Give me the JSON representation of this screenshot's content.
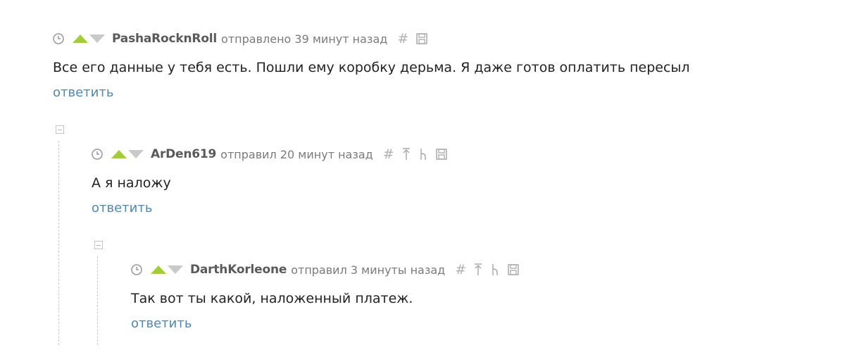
{
  "comments": [
    {
      "username": "PashaRocknRoll",
      "sent": "отправлено 39 минут назад",
      "text": "Все его данные у тебя есть. Пошли ему коробку дерьма. Я даже готов оплатить пересыл",
      "reply": "ответить",
      "tools": [
        "#"
      ]
    },
    {
      "username": "ArDen619",
      "sent": "отправил 20 минут назад",
      "text": "А я наложу",
      "reply": "ответить",
      "tools": [
        "#",
        "↑",
        "⋮"
      ]
    },
    {
      "username": "DarthKorleone",
      "sent": "отправил 3 минуты назад",
      "text": "Так вот ты какой, наложенный платеж.",
      "reply": "ответить",
      "tools": [
        "#",
        "↑",
        "⋮"
      ]
    }
  ],
  "icons": {
    "clock": "clock-icon",
    "vote_up": "upvote-icon",
    "vote_down": "downvote-icon",
    "permalink": "hash-icon",
    "parent": "arrow-up-icon",
    "branch": "branch-icon",
    "save": "save-icon",
    "collapse": "collapse-minus-icon"
  },
  "colors": {
    "upvote": "#a2cc3a",
    "downvote": "#c9c9c9",
    "username": "#5a5a5a",
    "link": "#4f87b2",
    "meta": "#7a7a7a"
  }
}
